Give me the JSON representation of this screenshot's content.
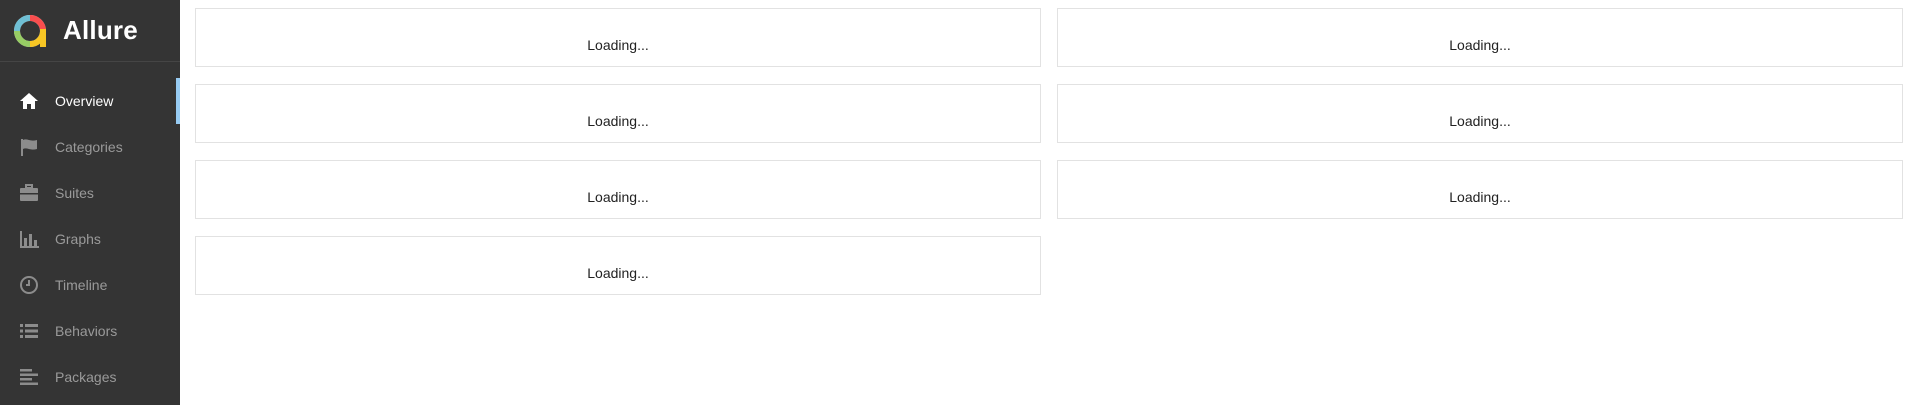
{
  "brand": {
    "title": "Allure"
  },
  "sidebar": {
    "items": [
      {
        "label": "Overview",
        "icon": "home-icon",
        "active": true
      },
      {
        "label": "Categories",
        "icon": "flag-icon",
        "active": false
      },
      {
        "label": "Suites",
        "icon": "briefcase-icon",
        "active": false
      },
      {
        "label": "Graphs",
        "icon": "bar-chart-icon",
        "active": false
      },
      {
        "label": "Timeline",
        "icon": "clock-icon",
        "active": false
      },
      {
        "label": "Behaviors",
        "icon": "list-icon",
        "active": false
      },
      {
        "label": "Packages",
        "icon": "align-left-icon",
        "active": false
      }
    ]
  },
  "widgets": [
    {
      "text": "Loading..."
    },
    {
      "text": "Loading..."
    },
    {
      "text": "Loading..."
    },
    {
      "text": "Loading..."
    },
    {
      "text": "Loading..."
    },
    {
      "text": "Loading..."
    },
    {
      "text": "Loading..."
    }
  ],
  "colors": {
    "sidebar_bg": "#343434",
    "active_indicator": "#97cbf2",
    "inactive_text": "#9a9a9a"
  }
}
